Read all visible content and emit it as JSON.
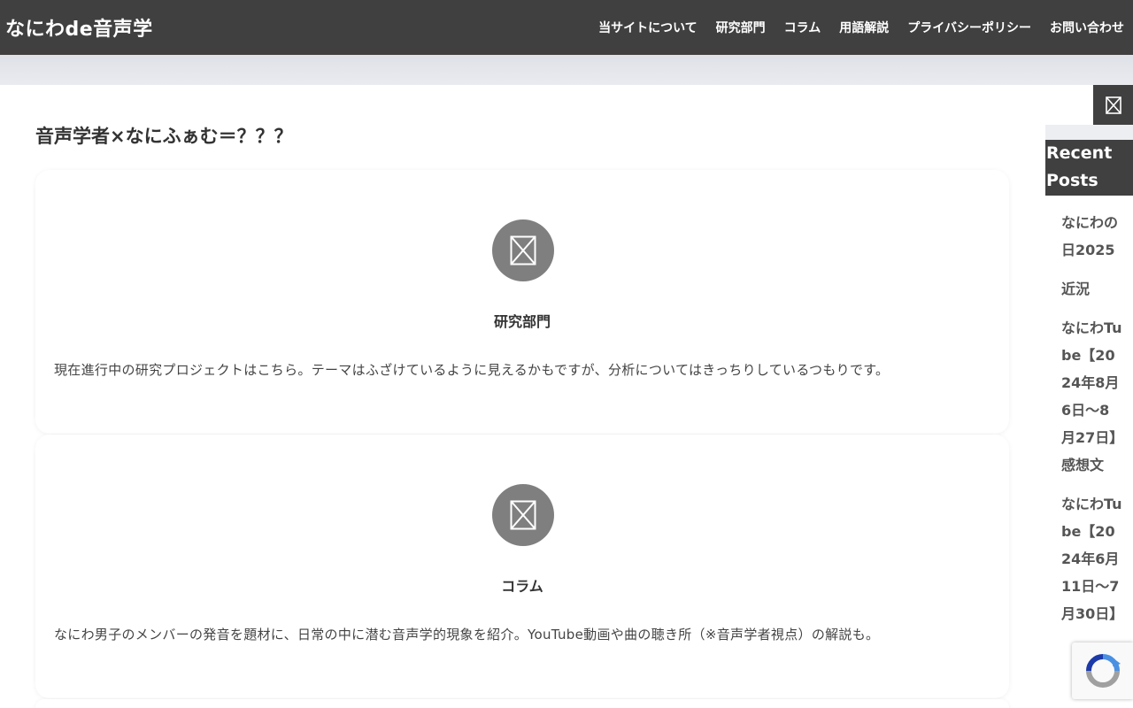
{
  "header": {
    "site_title": "なにわde音声学",
    "nav": [
      {
        "label": "当サイトについて"
      },
      {
        "label": "研究部門"
      },
      {
        "label": "コラム"
      },
      {
        "label": "用語解説"
      },
      {
        "label": "プライバシーポリシー"
      },
      {
        "label": "お問い合わせ"
      }
    ]
  },
  "main": {
    "page_title": "音声学者×なにふぁむ＝？？？",
    "cards": [
      {
        "icon": "missing-image-icon",
        "title": "研究部門",
        "description": "現在進行中の研究プロジェクトはこちら。テーマはふざけているように見えるかもですが、分析についてはきっちりしているつもりです。"
      },
      {
        "icon": "missing-image-icon",
        "title": "コラム",
        "description": "なにわ男子のメンバーの発音を題材に、日常の中に潜む音声学的現象を紹介。YouTube動画や曲の聴き所（※音声学者視点）の解説も。"
      }
    ]
  },
  "sidebar": {
    "toggle_icon": "missing-image-icon",
    "widget_title": "Recent Posts",
    "recent_posts": [
      "なにわの日2025",
      "近況",
      "なにわTube【2024年8月6日～8月27日】感想文",
      "なにわTube【2024年6月11日～7月30日】"
    ]
  },
  "recaptcha": {
    "icon": "recaptcha-icon"
  },
  "colors": {
    "header_bg": "#404040",
    "icon_circle": "#7f7f7f",
    "page_bg": "#f4f5f8"
  }
}
